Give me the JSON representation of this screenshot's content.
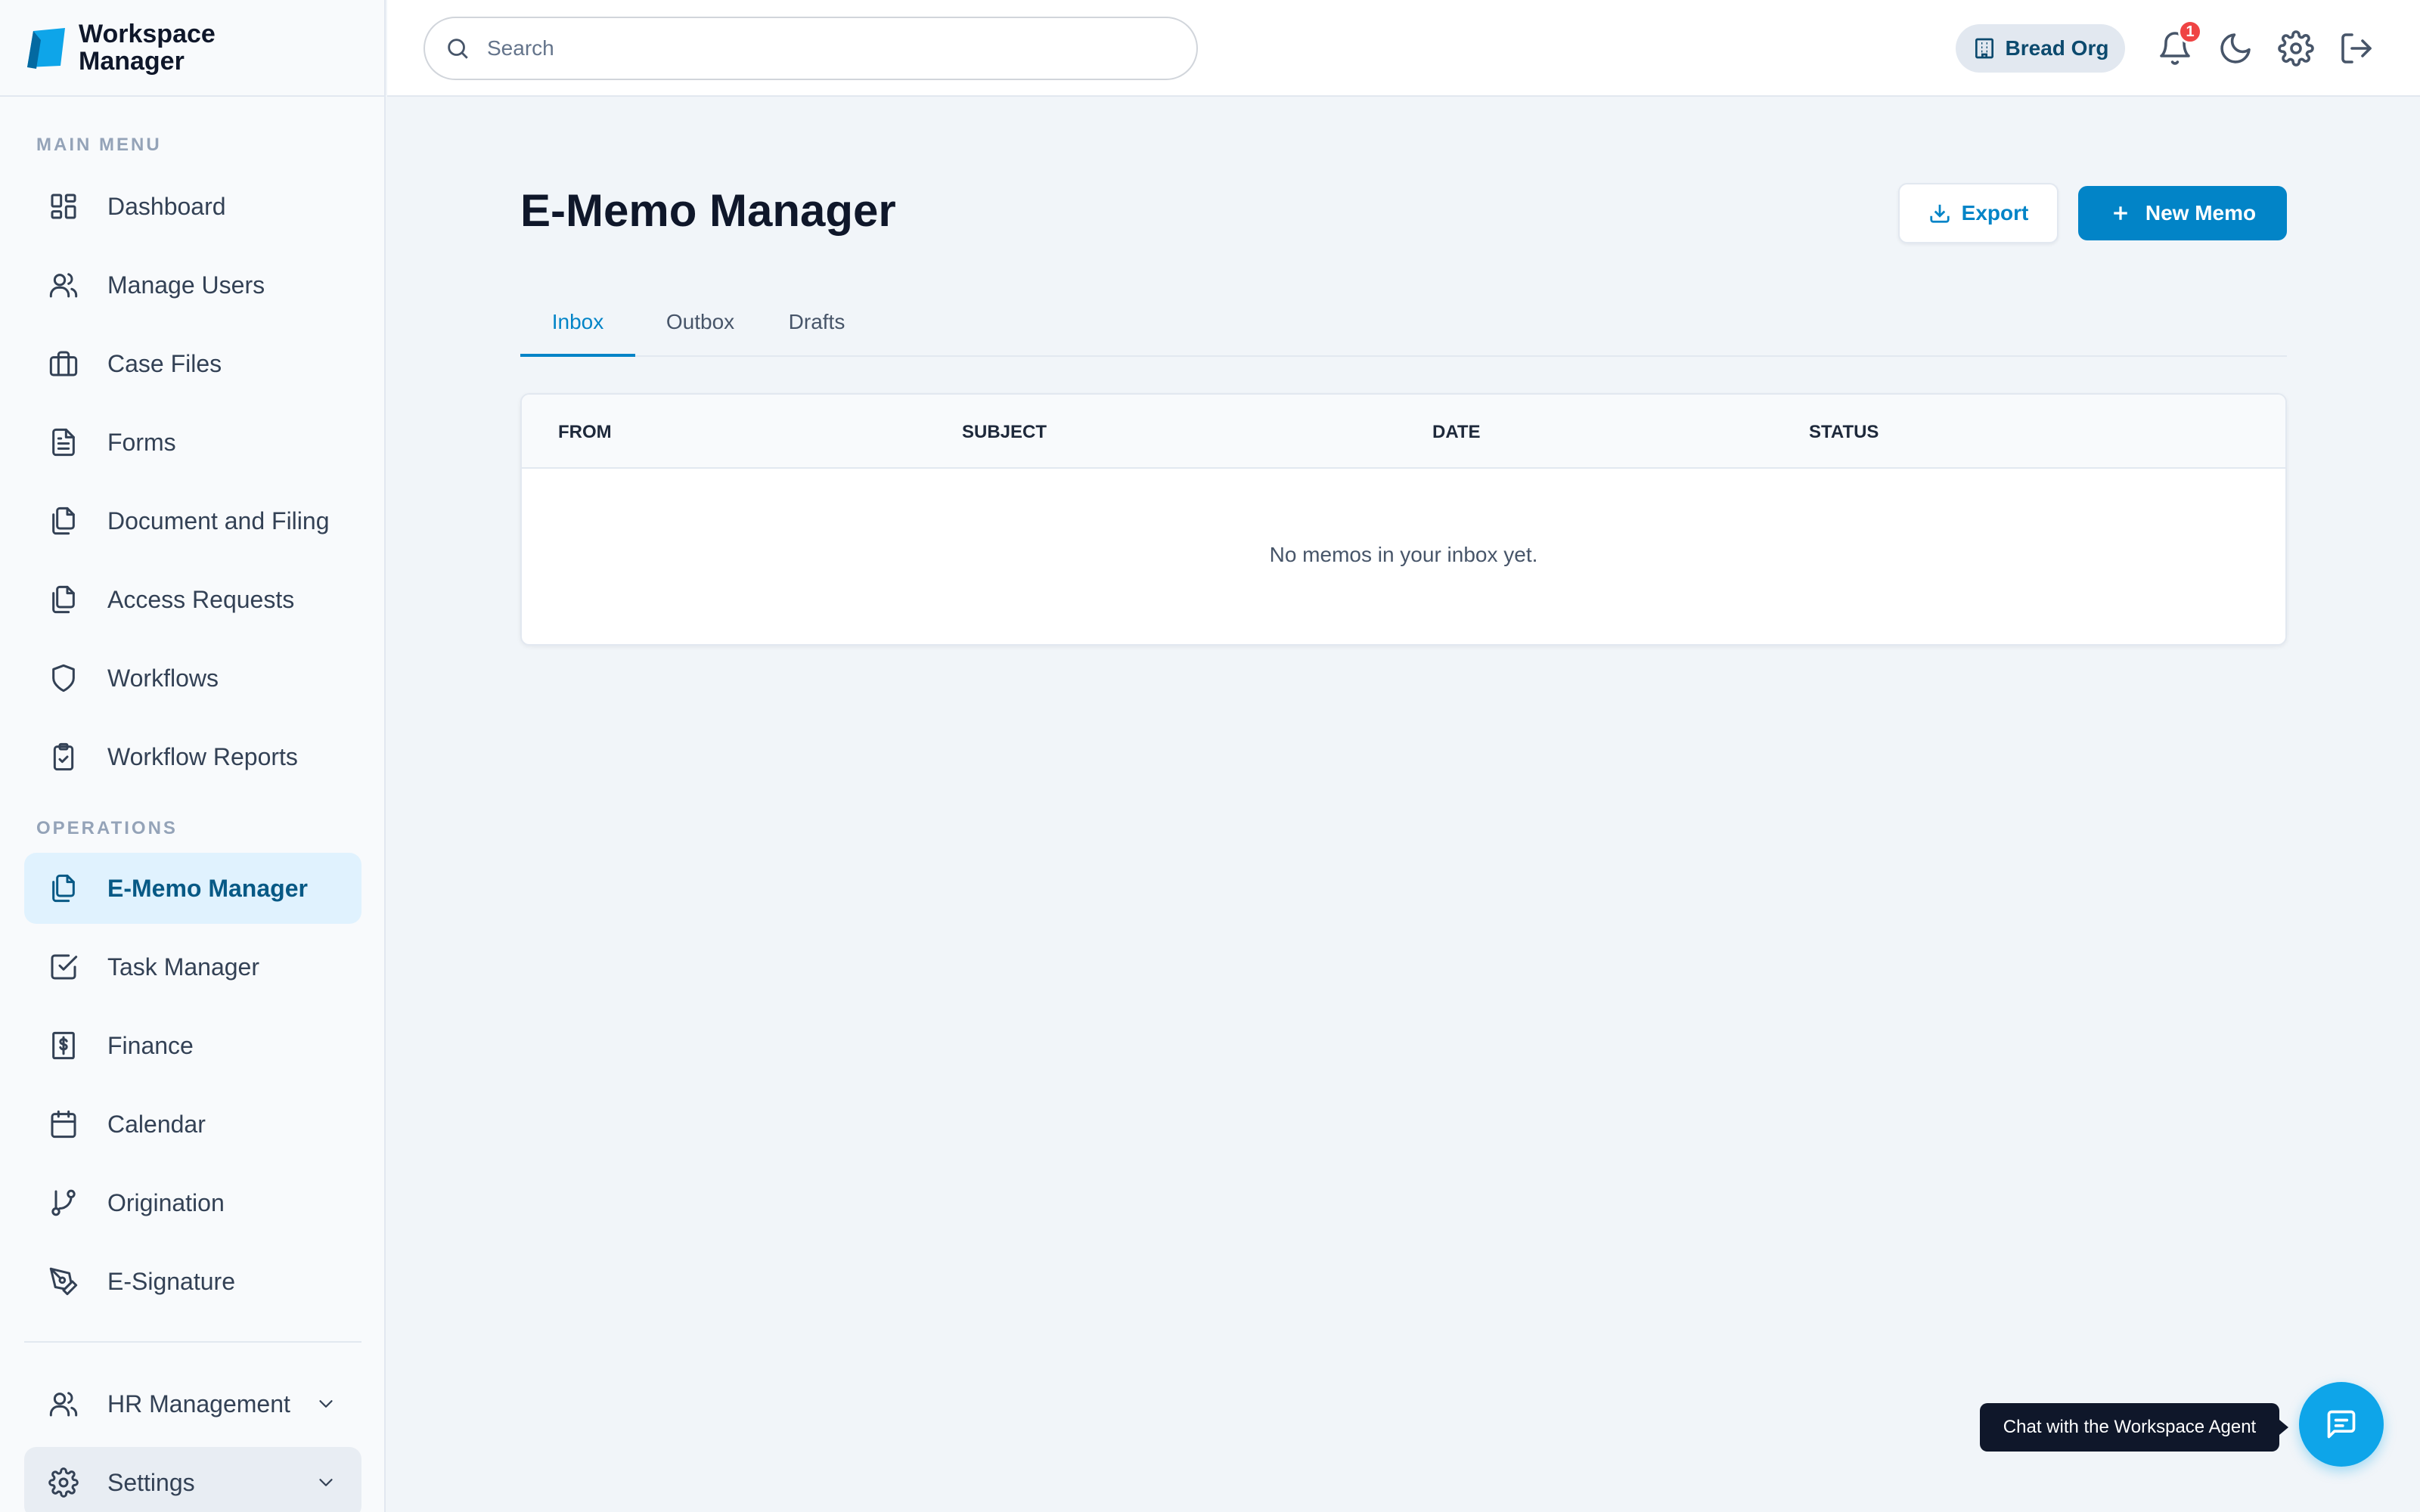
{
  "brand": {
    "line1": "Workspace",
    "line2": "Manager"
  },
  "sidebar": {
    "main_menu_label": "MAIN MENU",
    "operations_label": "OPERATIONS",
    "main_items": [
      {
        "label": "Dashboard",
        "icon": "dashboard-icon"
      },
      {
        "label": "Manage Users",
        "icon": "users-icon"
      },
      {
        "label": "Case Files",
        "icon": "briefcase-icon"
      },
      {
        "label": "Forms",
        "icon": "file-text-icon"
      },
      {
        "label": "Document and Filing",
        "icon": "files-icon"
      },
      {
        "label": "Access Requests",
        "icon": "files-icon"
      },
      {
        "label": "Workflows",
        "icon": "shield-icon"
      },
      {
        "label": "Workflow Reports",
        "icon": "clipboard-check-icon"
      }
    ],
    "operation_items": [
      {
        "label": "E-Memo Manager",
        "icon": "files-icon",
        "active": true
      },
      {
        "label": "Task Manager",
        "icon": "check-square-icon"
      },
      {
        "label": "Finance",
        "icon": "dollar-receipt-icon"
      },
      {
        "label": "Calendar",
        "icon": "calendar-icon"
      },
      {
        "label": "Origination",
        "icon": "git-branch-icon"
      },
      {
        "label": "E-Signature",
        "icon": "pen-tool-icon"
      }
    ],
    "bottom_items": [
      {
        "label": "HR Management",
        "icon": "users-icon"
      },
      {
        "label": "Settings",
        "icon": "gear-icon"
      }
    ]
  },
  "topbar": {
    "search_placeholder": "Search",
    "org_name": "Bread Org",
    "notification_count": "1"
  },
  "main": {
    "title": "E-Memo Manager",
    "export_label": "Export",
    "new_memo_label": "New Memo",
    "tabs": [
      "Inbox",
      "Outbox",
      "Drafts"
    ],
    "active_tab": "Inbox",
    "columns": [
      "FROM",
      "SUBJECT",
      "DATE",
      "STATUS"
    ],
    "empty_message": "No memos in your inbox yet."
  },
  "chat": {
    "tooltip": "Chat with the Workspace Agent"
  },
  "colors": {
    "accent": "#0284c7",
    "active_bg": "#e0f2fe",
    "badge": "#ef4444"
  }
}
